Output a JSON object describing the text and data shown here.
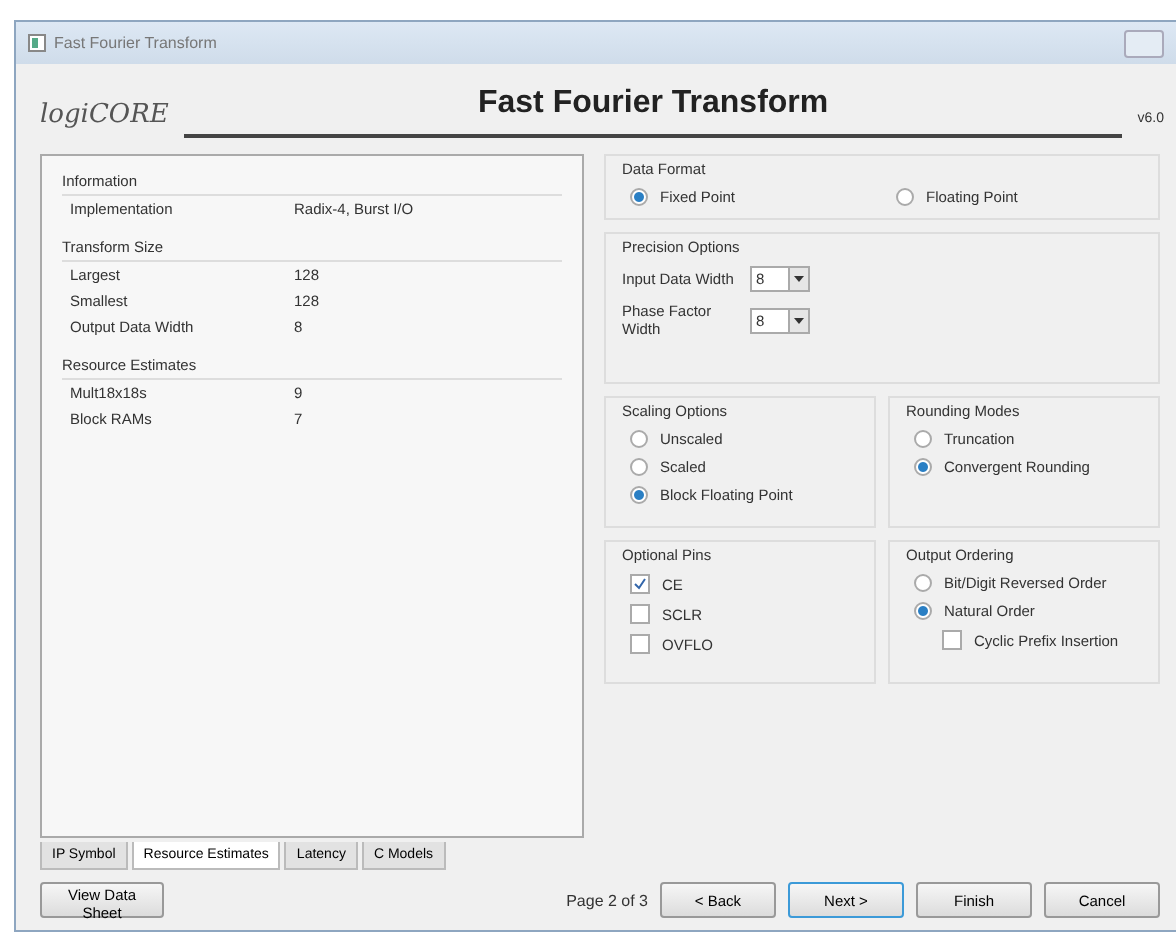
{
  "window": {
    "title": "Fast Fourier Transform"
  },
  "header": {
    "logo": "logiCORE",
    "title": "Fast Fourier Transform",
    "version": "v6.0"
  },
  "summary": [
    {
      "heading": "Information",
      "rows": [
        {
          "label": "Implementation",
          "value": "Radix-4, Burst I/O"
        }
      ]
    },
    {
      "heading": "Transform Size",
      "rows": [
        {
          "label": "Largest",
          "value": "128"
        },
        {
          "label": "Smallest",
          "value": "128"
        },
        {
          "label": "Output Data Width",
          "value": "8"
        }
      ]
    },
    {
      "heading": "Resource Estimates",
      "rows": [
        {
          "label": "Mult18x18s",
          "value": "9"
        },
        {
          "label": "Block RAMs",
          "value": "7"
        }
      ]
    }
  ],
  "tabs": [
    {
      "label": "IP Symbol",
      "selected": false
    },
    {
      "label": "Resource Estimates",
      "selected": true
    },
    {
      "label": "Latency",
      "selected": false
    },
    {
      "label": "C Models",
      "selected": false
    }
  ],
  "data_format": {
    "title": "Data Format",
    "options": [
      {
        "label": "Fixed Point",
        "selected": true
      },
      {
        "label": "Floating Point",
        "selected": false
      }
    ]
  },
  "precision": {
    "title": "Precision Options",
    "fields": [
      {
        "label": "Input Data Width",
        "value": "8"
      },
      {
        "label": "Phase Factor Width",
        "value": "8"
      }
    ]
  },
  "scaling": {
    "title": "Scaling Options",
    "options": [
      {
        "label": "Unscaled",
        "selected": false
      },
      {
        "label": "Scaled",
        "selected": false
      },
      {
        "label": "Block Floating Point",
        "selected": true
      }
    ]
  },
  "rounding": {
    "title": "Rounding Modes",
    "options": [
      {
        "label": "Truncation",
        "selected": false
      },
      {
        "label": "Convergent Rounding",
        "selected": true
      }
    ]
  },
  "optional_pins": {
    "title": "Optional Pins",
    "items": [
      {
        "label": "CE",
        "checked": true
      },
      {
        "label": "SCLR",
        "checked": false
      },
      {
        "label": "OVFLO",
        "checked": false
      }
    ]
  },
  "output_ordering": {
    "title": "Output Ordering",
    "options": [
      {
        "label": "Bit/Digit Reversed Order",
        "selected": false
      },
      {
        "label": "Natural Order",
        "selected": true
      }
    ],
    "cyclic": {
      "label": "Cyclic Prefix Insertion",
      "checked": false
    }
  },
  "footer": {
    "datasheet": "View Data Sheet",
    "page": "Page 2 of 3",
    "buttons": [
      {
        "label": "< Back",
        "default": false
      },
      {
        "label": "Next >",
        "default": true
      },
      {
        "label": "Finish",
        "default": false
      },
      {
        "label": "Cancel",
        "default": false
      }
    ]
  }
}
